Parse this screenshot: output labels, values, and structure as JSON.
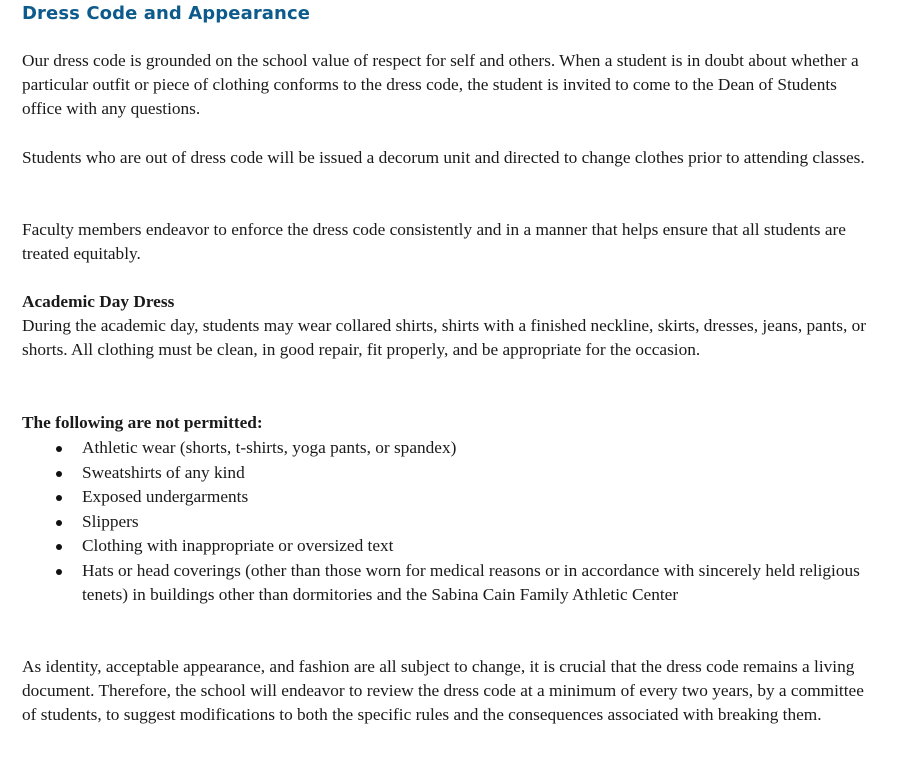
{
  "document": {
    "title": "Dress Code and Appearance",
    "paragraphs": [
      "Our dress code is grounded on the school value of respect for self and others. When a student is in doubt about whether a particular outfit or piece of clothing conforms to the dress code, the student is invited to come to the Dean of Students office with any questions.",
      "Students who are out of dress code will be issued a decorum unit and directed to change clothes prior to attending classes.",
      "Faculty members endeavor to enforce the dress code consistently and in a manner that helps ensure that all students are treated equitably."
    ],
    "academic": {
      "heading": "Academic Day Dress",
      "text": "During the academic day, students may wear collared shirts, shirts with a finished neckline, skirts, dresses, jeans, pants, or shorts.  All clothing must be clean, in good repair, fit properly, and be appropriate for the occasion."
    },
    "not_permitted": {
      "heading": "The following are not permitted:",
      "items": [
        "Athletic wear (shorts, t-shirts, yoga pants, or spandex)",
        "Sweatshirts of any kind",
        "Exposed undergarments",
        "Slippers",
        "Clothing with inappropriate or oversized text",
        "Hats or head coverings (other than those worn for medical reasons or in accordance with sincerely held religious tenets) in buildings other than dormitories and the Sabina Cain Family Athletic Center"
      ]
    },
    "closing": "As identity, acceptable appearance, and fashion are all subject to change, it is crucial that the dress code remains a living document. Therefore, the school will endeavor to review the dress code at a minimum of every two years, by a committee of students, to suggest modifications to both the specific rules and the consequences associated with breaking them."
  }
}
